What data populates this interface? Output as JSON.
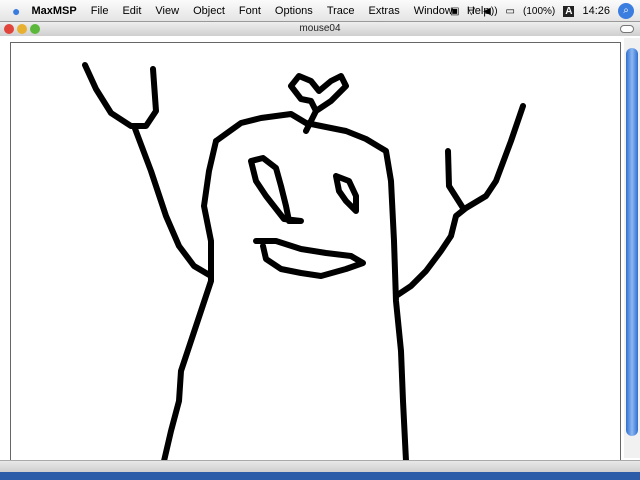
{
  "menubar": {
    "apple_icon": "apple-logo",
    "items": [
      "MaxMSP",
      "File",
      "Edit",
      "View",
      "Object",
      "Font",
      "Options",
      "Trace",
      "Extras",
      "Window",
      "Help"
    ],
    "battery": "(100%)",
    "keyboard": "A",
    "clock": "14:26",
    "spotlight_icon": "spotlight-icon"
  },
  "window": {
    "title": "mouse04"
  }
}
